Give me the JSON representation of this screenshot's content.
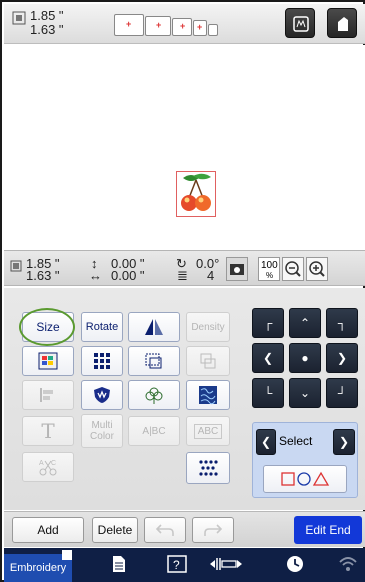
{
  "top": {
    "width": "1.85 \"",
    "height": "1.63 \""
  },
  "info": {
    "width": "1.85 \"",
    "height": "1.63 \"",
    "offset_x": "0.00 \"",
    "offset_y": "0.00 \"",
    "angle": "0.0°",
    "color_count": "4",
    "zoom": "100",
    "zoom_unit": "%"
  },
  "tools": {
    "size": "Size",
    "rotate": "Rotate",
    "density": "Density",
    "multi_color_line1": "Multi",
    "multi_color_line2": "Color",
    "abc": "A|BC",
    "abc_frame": "ABC",
    "select": "Select"
  },
  "actions": {
    "add": "Add",
    "delete": "Delete",
    "edit_end": "Edit End"
  },
  "status": {
    "tab": "Embroidery"
  },
  "colors": {
    "accent": "#1238d8",
    "dark_bar": "#0f1f45",
    "select_bg": "#c9d8f2",
    "size_highlight": "#5a9a2f"
  }
}
